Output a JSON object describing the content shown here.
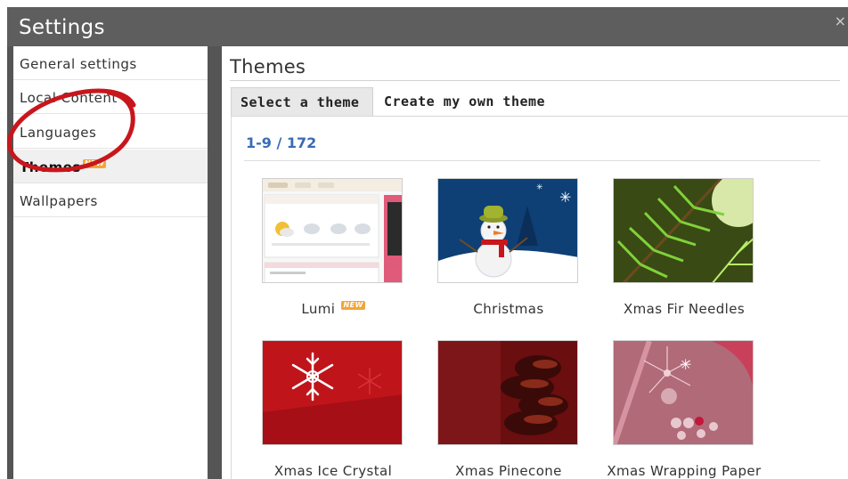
{
  "window": {
    "title": "Settings",
    "close_glyph": "×"
  },
  "sidebar": {
    "items": [
      {
        "label": "General settings",
        "active": false
      },
      {
        "label": "Local Content",
        "active": false
      },
      {
        "label": "Languages",
        "active": false
      },
      {
        "label": "Themes",
        "active": true,
        "badge": "NEW"
      },
      {
        "label": "Wallpapers",
        "active": false
      }
    ]
  },
  "content": {
    "title": "Themes",
    "tabs": [
      {
        "label": "Select a theme",
        "selected": true
      },
      {
        "label": "Create my own theme",
        "selected": false
      }
    ],
    "counter": "1-9 / 172",
    "themes": [
      {
        "name": "Lumi",
        "badge": "NEW"
      },
      {
        "name": "Christmas"
      },
      {
        "name": "Xmas Fir Needles"
      },
      {
        "name": "Xmas Ice Crystal"
      },
      {
        "name": "Xmas Pinecone"
      },
      {
        "name": "Xmas Wrapping Paper"
      }
    ]
  },
  "colors": {
    "frame": "#555555",
    "accent_blue": "#3a6bb5",
    "badge_orange": "#f0a63a",
    "annotation_red": "#c8161d"
  },
  "icons": {
    "close": "close-icon"
  }
}
